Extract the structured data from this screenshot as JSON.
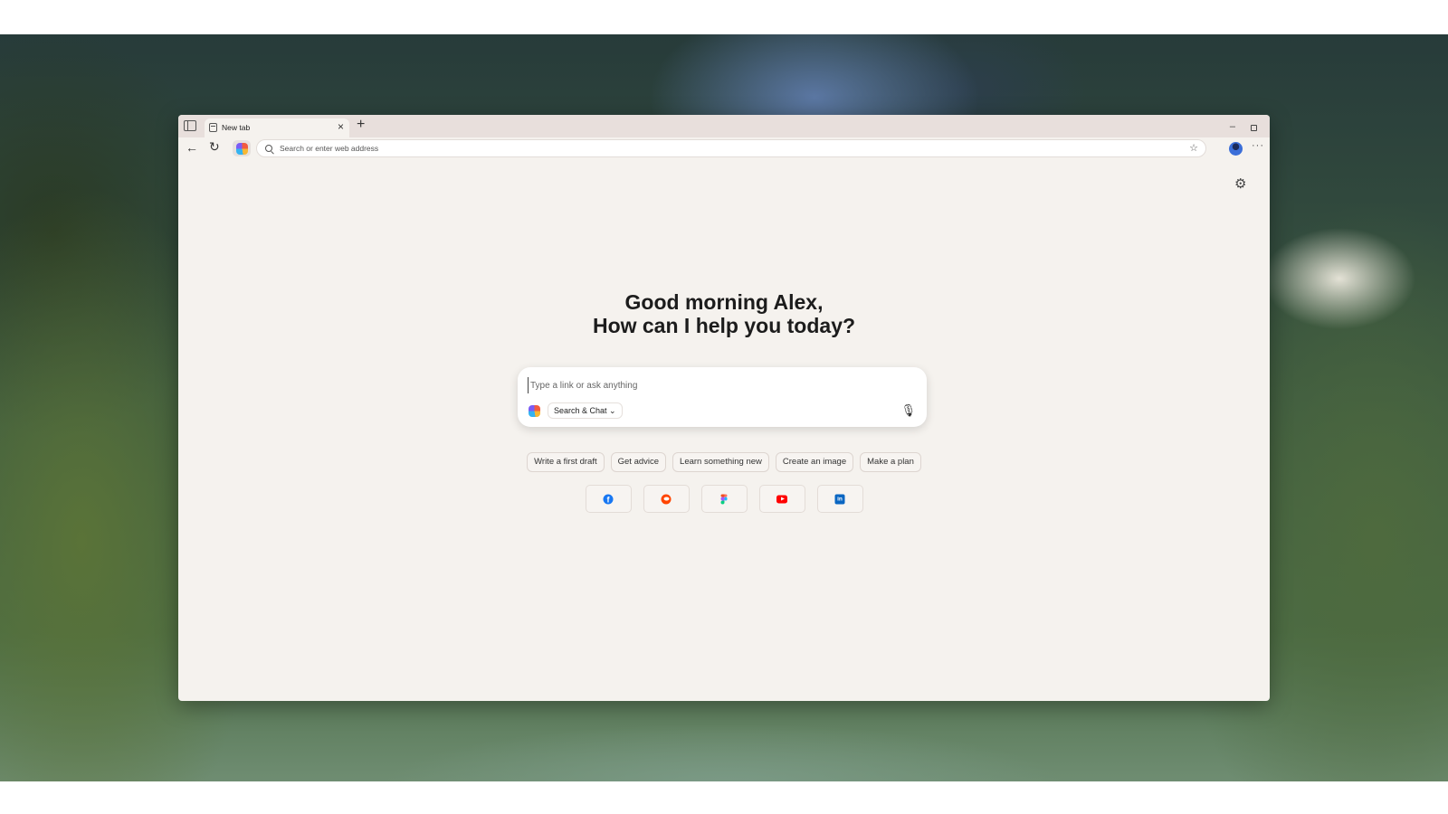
{
  "browser": {
    "tab": {
      "title": "New tab",
      "close_glyph": "×"
    },
    "new_tab_glyph": "+",
    "window_controls": {
      "minimize_glyph": "–"
    },
    "toolbar": {
      "back_glyph": "←",
      "reload_glyph": "↻",
      "address_placeholder": "Search or enter web address",
      "favorites_glyph": "☆",
      "more_glyph": "···"
    }
  },
  "newtab": {
    "settings_glyph": "⚙",
    "greeting_line1": "Good morning Alex,",
    "greeting_line2": "How can I help you today?",
    "composer": {
      "placeholder": "Type a link or ask anything",
      "mode_label": "Search & Chat",
      "mode_chevron": "⌄",
      "mic_glyph": "🎙"
    },
    "suggestions": [
      "Write a first draft",
      "Get advice",
      "Learn something new",
      "Create an image",
      "Make a plan"
    ],
    "sites": [
      {
        "name": "facebook",
        "glyph": "f",
        "color": "#1877f2"
      },
      {
        "name": "reddit",
        "color": "#ff4500"
      },
      {
        "name": "figma",
        "color": "#f24e1e"
      },
      {
        "name": "youtube",
        "color": "#ff0000"
      },
      {
        "name": "linkedin",
        "glyph": "in",
        "color": "#0a66c2"
      }
    ]
  },
  "colors": {
    "page_background": "#f5f2ee",
    "tabstrip": "#e8dfdc",
    "text_primary": "#1c1c1c"
  }
}
